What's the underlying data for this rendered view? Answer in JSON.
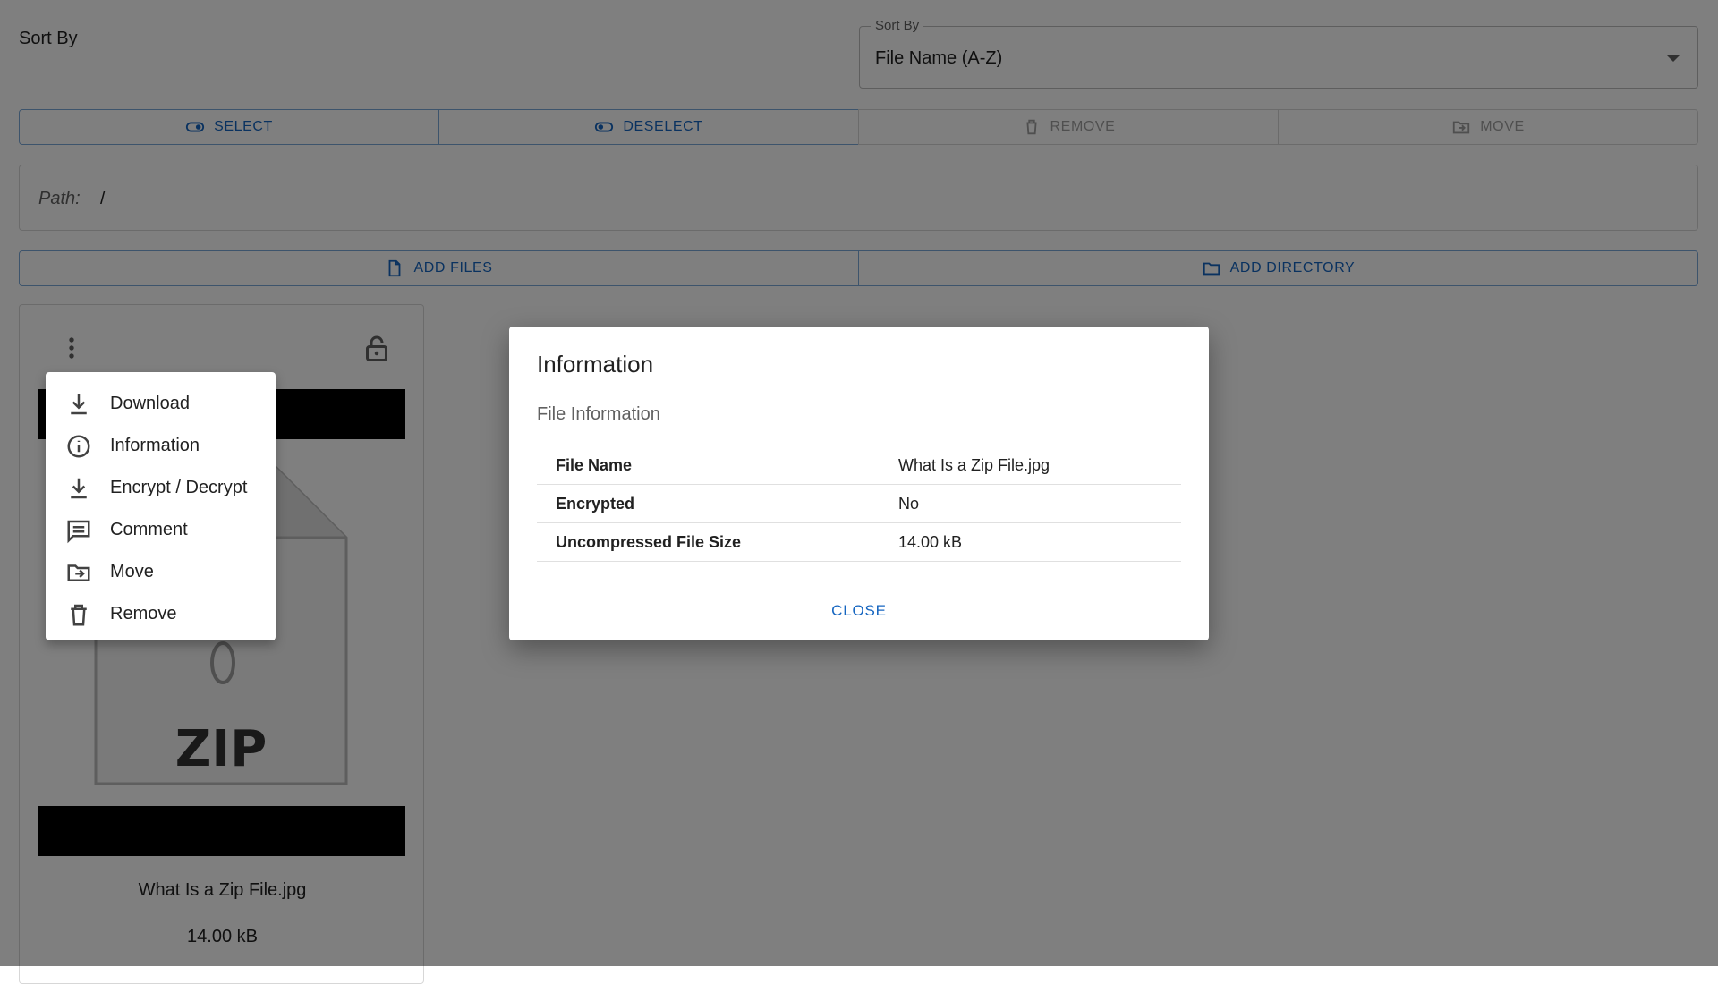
{
  "sort": {
    "label": "Sort By",
    "select_legend": "Sort By",
    "select_value": "File Name (A-Z)"
  },
  "actions": {
    "select": "SELECT",
    "deselect": "DESELECT",
    "remove": "REMOVE",
    "move": "MOVE"
  },
  "path": {
    "label": "Path:",
    "value": "/"
  },
  "add": {
    "files": "ADD FILES",
    "directory": "ADD DIRECTORY"
  },
  "file_card": {
    "name": "What Is a Zip File.jpg",
    "size": "14.00 kB",
    "image_text": "ZIP"
  },
  "menu": {
    "items": [
      {
        "label": "Download",
        "icon": "download-icon"
      },
      {
        "label": "Information",
        "icon": "info-icon"
      },
      {
        "label": "Encrypt / Decrypt",
        "icon": "encrypt-icon"
      },
      {
        "label": "Comment",
        "icon": "comment-icon"
      },
      {
        "label": "Move",
        "icon": "move-icon"
      },
      {
        "label": "Remove",
        "icon": "trash-icon"
      }
    ]
  },
  "dialog": {
    "title": "Information",
    "subtitle": "File Information",
    "rows": [
      {
        "key": "File Name",
        "value": "What Is a Zip File.jpg"
      },
      {
        "key": "Encrypted",
        "value": "No"
      },
      {
        "key": "Uncompressed File Size",
        "value": "14.00 kB"
      }
    ],
    "close": "CLOSE"
  },
  "colors": {
    "accent": "#1565c0",
    "overlay": "rgba(0,0,0,0.5)"
  }
}
